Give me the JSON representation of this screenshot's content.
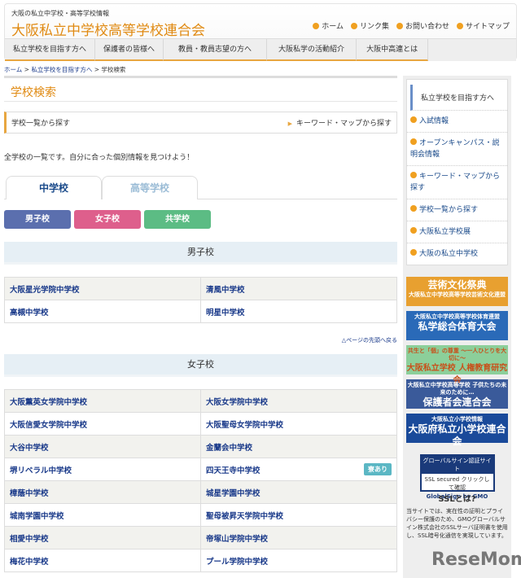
{
  "header": {
    "tagline": "大阪の私立中学校・高等学校情報",
    "title": "大阪私立中学校高等学校連合会",
    "util_links": [
      "ホーム",
      "リンク集",
      "お問い合わせ",
      "サイトマップ"
    ]
  },
  "nav": [
    "私立学校を目指す方へ",
    "保護者の皆様へ",
    "教員・教員志望の方へ",
    "大阪私学の活動紹介",
    "大阪中高連とは"
  ],
  "breadcrumb": {
    "home": "ホーム",
    "parent": "私立学校を目指す方へ",
    "current": "学校検索",
    "sep": " > "
  },
  "main": {
    "title": "学校検索",
    "subnav_left": "学校一覧から探す",
    "subnav_right": "キーワード・マップから探す",
    "intro": "全学校の一覧です。自分に合った個別情報を見つけよう！",
    "tabs": [
      "中学校",
      "高等学校"
    ],
    "filters": [
      "男子校",
      "女子校",
      "共学校"
    ],
    "boys_heading": "男子校",
    "boys": [
      [
        "大阪星光学院中学校",
        "清風中学校"
      ],
      [
        "高槻中学校",
        "明星中学校"
      ]
    ],
    "back_to_top": "△ページの先頭へ戻る",
    "girls_heading": "女子校",
    "girls": [
      [
        "大阪薫英女学院中学校",
        "大阪女学院中学校"
      ],
      [
        "大阪信愛女学院中学校",
        "大阪聖母女学院中学校"
      ],
      [
        "大谷中学校",
        "金蘭会中学校"
      ],
      [
        "堺リベラル中学校",
        "四天王寺中学校"
      ],
      [
        "樟蔭中学校",
        "城星学園中学校"
      ],
      [
        "城南学園中学校",
        "聖母被昇天学院中学校"
      ],
      [
        "相愛中学校",
        "帝塚山学院中学校"
      ],
      [
        "梅花中学校",
        "プール学院中学校"
      ]
    ],
    "dorm_badge": "寮あり"
  },
  "sidebar": {
    "heading": "私立学校を目指す方へ",
    "items": [
      "入試情報",
      "オープンキャンパス・説明会情報",
      "キーワード・マップから探す",
      "学校一覧から探す",
      "大阪私立学校展",
      "大阪の私立中学校"
    ],
    "banners": [
      {
        "title": "芸術文化祭典",
        "sub": "大阪私立中学校高等学校芸術文化連盟"
      },
      {
        "title": "私学総合体育大会",
        "sub": "大阪私立中学校高等学校体育連盟"
      },
      {
        "title": "大阪私立学校 人権教育研究会",
        "sub": "共生と「個」の尊重 〜一人ひとりを大切に〜"
      },
      {
        "title": "保護者会連合会",
        "sub": "大阪私立中学校高等学校 子供たちの未来のために…"
      },
      {
        "title": "大阪府私立小学校連合会",
        "sub": "大阪私立小学校情報"
      }
    ],
    "ssl_title": "グローバルサイン認証サイト",
    "ssl_badge": "SSL secured クリックして確認",
    "ssl_brand": "GlobalSign by GMO",
    "ssl_link": "SSLとは?",
    "ssl_text": "当サイトでは、実在性の証明とプライバシー保護のため、GMOグローバルサイン株式会社のSSLサーバ証明書を使用し、SSL暗号化通信を実現しています。"
  },
  "watermark": "ReseMom"
}
